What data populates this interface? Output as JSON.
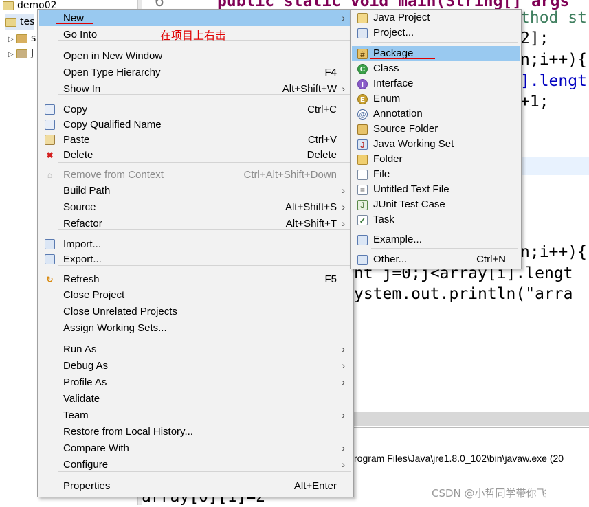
{
  "tree": {
    "items": [
      {
        "label": "demo02"
      },
      {
        "label": "tes"
      },
      {
        "label": "s"
      },
      {
        "label": "J"
      }
    ]
  },
  "editor": {
    "line_number": "6",
    "lines": [
      {
        "text": "public static void main(String[] args"
      },
      {
        "text": "thod st"
      },
      {
        "text": "2];"
      },
      {
        "text": "n;i++){"
      },
      {
        "text": "].lengt"
      },
      {
        "text": "+1;"
      },
      {
        "text": "n;i++){"
      },
      {
        "text": "nt j=0;j<array[i].lengt"
      },
      {
        "text": "ystem.out.println(\"arra"
      },
      {
        "text": "array[0][1]=2"
      }
    ]
  },
  "console": {
    "path": "rogram Files\\Java\\jre1.8.0_102\\bin\\javaw.exe (20"
  },
  "annotation": {
    "note": "在项目上右击"
  },
  "watermark": "CSDN @小哲同学带你飞",
  "context_menu": {
    "items": [
      {
        "label": "New",
        "shortcut": "",
        "submenu": true,
        "highlight": true
      },
      {
        "label": "Go Into",
        "shortcut": ""
      },
      {
        "label": "Open in New Window",
        "shortcut": ""
      },
      {
        "label": "Open Type Hierarchy",
        "shortcut": "F4"
      },
      {
        "label": "Show In",
        "shortcut": "Alt+Shift+W",
        "submenu": true
      },
      {
        "label": "Copy",
        "shortcut": "Ctrl+C",
        "icon": "copy-icon"
      },
      {
        "label": "Copy Qualified Name",
        "shortcut": "",
        "icon": "copy-qualified-icon"
      },
      {
        "label": "Paste",
        "shortcut": "Ctrl+V",
        "icon": "paste-icon"
      },
      {
        "label": "Delete",
        "shortcut": "Delete",
        "icon": "delete-icon"
      },
      {
        "label": "Remove from Context",
        "shortcut": "Ctrl+Alt+Shift+Down",
        "disabled": true,
        "icon": "remove-context-icon"
      },
      {
        "label": "Build Path",
        "shortcut": "",
        "submenu": true
      },
      {
        "label": "Source",
        "shortcut": "Alt+Shift+S",
        "submenu": true
      },
      {
        "label": "Refactor",
        "shortcut": "Alt+Shift+T",
        "submenu": true
      },
      {
        "label": "Import...",
        "shortcut": "",
        "icon": "import-icon"
      },
      {
        "label": "Export...",
        "shortcut": "",
        "icon": "export-icon"
      },
      {
        "label": "Refresh",
        "shortcut": "F5",
        "icon": "refresh-icon"
      },
      {
        "label": "Close Project",
        "shortcut": ""
      },
      {
        "label": "Close Unrelated Projects",
        "shortcut": ""
      },
      {
        "label": "Assign Working Sets...",
        "shortcut": ""
      },
      {
        "label": "Run As",
        "shortcut": "",
        "submenu": true
      },
      {
        "label": "Debug As",
        "shortcut": "",
        "submenu": true
      },
      {
        "label": "Profile As",
        "shortcut": "",
        "submenu": true
      },
      {
        "label": "Validate",
        "shortcut": ""
      },
      {
        "label": "Team",
        "shortcut": "",
        "submenu": true
      },
      {
        "label": "Restore from Local History...",
        "shortcut": ""
      },
      {
        "label": "Compare With",
        "shortcut": "",
        "submenu": true
      },
      {
        "label": "Configure",
        "shortcut": "",
        "submenu": true
      },
      {
        "label": "Properties",
        "shortcut": "Alt+Enter"
      }
    ]
  },
  "sub_menu": {
    "items": [
      {
        "label": "Java Project",
        "icon": "java-project-icon"
      },
      {
        "label": "Project...",
        "icon": "project-icon"
      },
      {
        "label": "Package",
        "icon": "package-icon",
        "highlight": true
      },
      {
        "label": "Class",
        "icon": "class-icon"
      },
      {
        "label": "Interface",
        "icon": "interface-icon"
      },
      {
        "label": "Enum",
        "icon": "enum-icon"
      },
      {
        "label": "Annotation",
        "icon": "annotation-icon"
      },
      {
        "label": "Source Folder",
        "icon": "source-folder-icon"
      },
      {
        "label": "Java Working Set",
        "icon": "working-set-icon"
      },
      {
        "label": "Folder",
        "icon": "folder-icon"
      },
      {
        "label": "File",
        "icon": "file-icon"
      },
      {
        "label": "Untitled Text File",
        "icon": "text-file-icon"
      },
      {
        "label": "JUnit Test Case",
        "icon": "junit-icon"
      },
      {
        "label": "Task",
        "icon": "task-icon"
      },
      {
        "label": "Example...",
        "icon": "example-icon"
      },
      {
        "label": "Other...",
        "shortcut": "Ctrl+N",
        "icon": "other-icon"
      }
    ]
  },
  "colors": {
    "highlight": "#99c9f0",
    "menu_bg": "#f2f2f2",
    "annotation_red": "#e00000"
  }
}
